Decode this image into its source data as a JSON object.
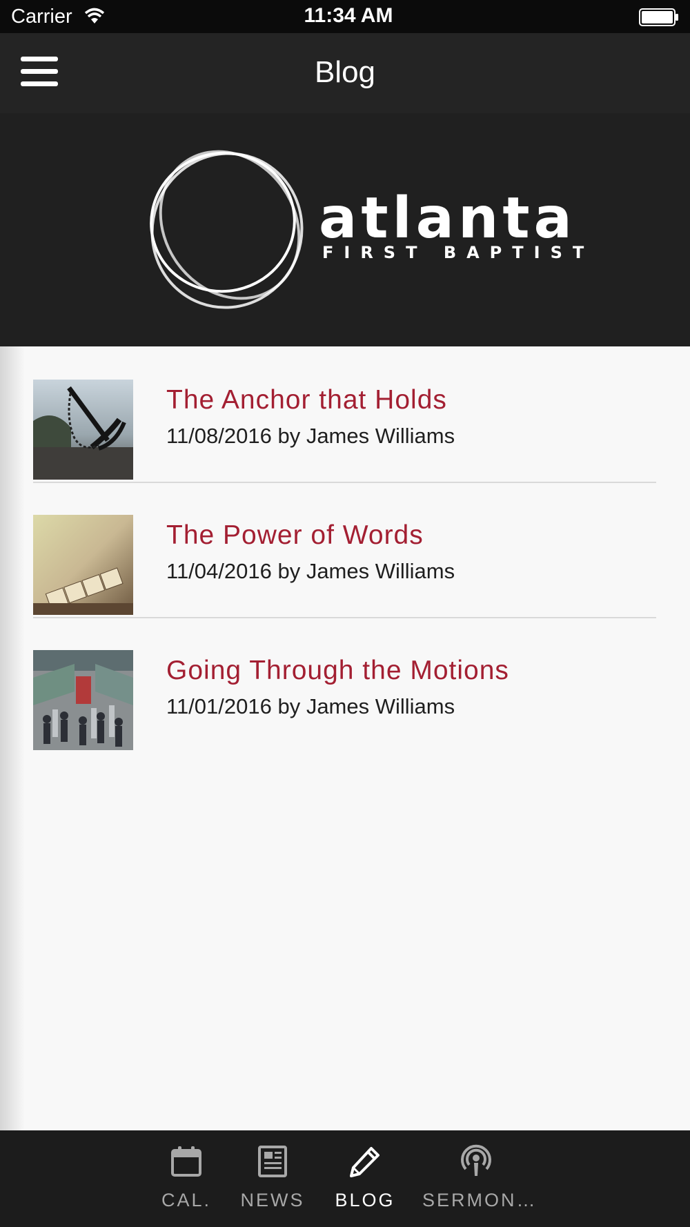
{
  "status_bar": {
    "carrier": "Carrier",
    "time": "11:34 AM"
  },
  "nav": {
    "title": "Blog"
  },
  "banner": {
    "logo_word": "atlanta",
    "logo_sub": "FIRST BAPTIST"
  },
  "posts": [
    {
      "title": "The Anchor that Holds",
      "meta": "11/08/2016 by James Williams"
    },
    {
      "title": "The Power of Words",
      "meta": "11/04/2016 by James Williams"
    },
    {
      "title": "Going Through the Motions",
      "meta": "11/01/2016 by James Williams"
    }
  ],
  "tabs": [
    {
      "label": "CAL.",
      "icon": "calendar-icon"
    },
    {
      "label": "NEWS",
      "icon": "newspaper-icon"
    },
    {
      "label": "BLOG",
      "icon": "pencil-icon",
      "active": true
    },
    {
      "label": "SERMON…",
      "icon": "podcast-icon"
    }
  ],
  "colors": {
    "accent": "#a31f32",
    "nav_bg": "#242424",
    "tab_bg": "#1c1c1c"
  }
}
